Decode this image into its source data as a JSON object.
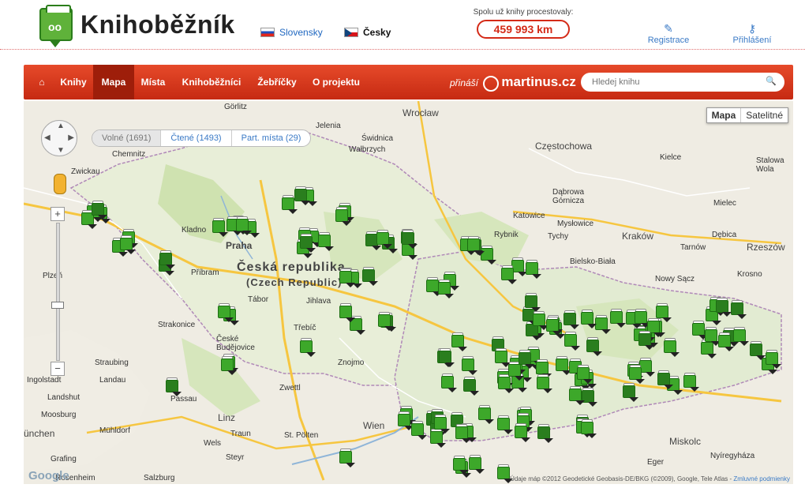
{
  "header": {
    "logo_text": "Knihoběžník",
    "languages": [
      {
        "label": "Slovensky",
        "flag": "slovak-flag-icon"
      },
      {
        "label": "Česky",
        "flag": "czech-flag-icon"
      }
    ],
    "km_label": "Spolu už knihy procestovaly:",
    "km_value": "459 993 km",
    "register_label": "Registrace",
    "login_label": "Přihlášení"
  },
  "nav": {
    "home_icon": "home-icon",
    "items": [
      "Knihy",
      "Mapa",
      "Místa",
      "Knihoběžníci",
      "Žebříčky",
      "O projektu"
    ],
    "active": "Mapa",
    "brand_prefix": "přináší",
    "brand_name": "martinus.cz",
    "search_placeholder": "Hledej knihu"
  },
  "map": {
    "filters": [
      "Volné (1691)",
      "Čtené (1493)",
      "Part. místa (29)"
    ],
    "selected_filter": "Volné (1691)",
    "map_types": [
      "Mapa",
      "Satelitné"
    ],
    "active_map_type": "Mapa",
    "labels": {
      "czech": "Česká republika",
      "czech_en": "(Czech Republic)",
      "praha": "Praha",
      "wroclaw": "Wrocław",
      "czestochowa": "Częstochowa",
      "katowice": "Katowice",
      "krakow": "Kraków",
      "tarnow": "Tarnów",
      "rzeszow": "Rzeszów",
      "wien": "Wien",
      "linz": "Linz",
      "salzburg": "Salzburg",
      "munchen": "ünchen",
      "ingolstadt": "Ingolstadt",
      "landshut": "Landshut",
      "zwickau": "Zwickau",
      "chemnitz": "Chemnitz",
      "jelenia": "Jelenia",
      "walbrzych": "Wałbrzych",
      "tychy": "Tychy",
      "bielsko": "Bielsko-Biała",
      "nowy_sacz": "Nowy Sącz",
      "kielce": "Kielce",
      "miskolc": "Miskolc",
      "nyiregyhaza": "Nyíregyháza",
      "eger": "Eger",
      "budejovice": "České Budějovice",
      "plzen": "Plzeň",
      "jihlava": "Jihlava",
      "tabor": "Tábor",
      "znojmo": "Znojmo",
      "strakonice": "Strakonice",
      "pribram": "Příbram",
      "kladno": "Kladno",
      "straubing": "Straubing",
      "landau": "Landau",
      "passau": "Passau",
      "gorlitz": "Görlitz",
      "swidnica": "Świdnica",
      "rybnik": "Rybnik",
      "dabrowa": "Dąbrowa Górnicza",
      "myslowice": "Mysłowice",
      "debica": "Dębica",
      "stalowa": "Stalowa Wola",
      "krosno": "Krosno",
      "steyr": "Steyr",
      "wels": "Wels",
      "st_polten": "St. Pölten",
      "mielec": "Mielec",
      "zwettl": "Zwettl",
      "trebic": "Třebíč",
      "grafing": "Grafing",
      "rosenheim": "Rosenheim",
      "moosburg": "Moosburg",
      "muhldorf": "Mühldorf",
      "traun": "Traun"
    },
    "google": "Google",
    "copyright": "Údaje máp ©2012 Geodetické Geobasis-DE/BKG (©2009), Google, Tele Atlas - ",
    "copyright_link": "Zmluvné podmienky"
  }
}
